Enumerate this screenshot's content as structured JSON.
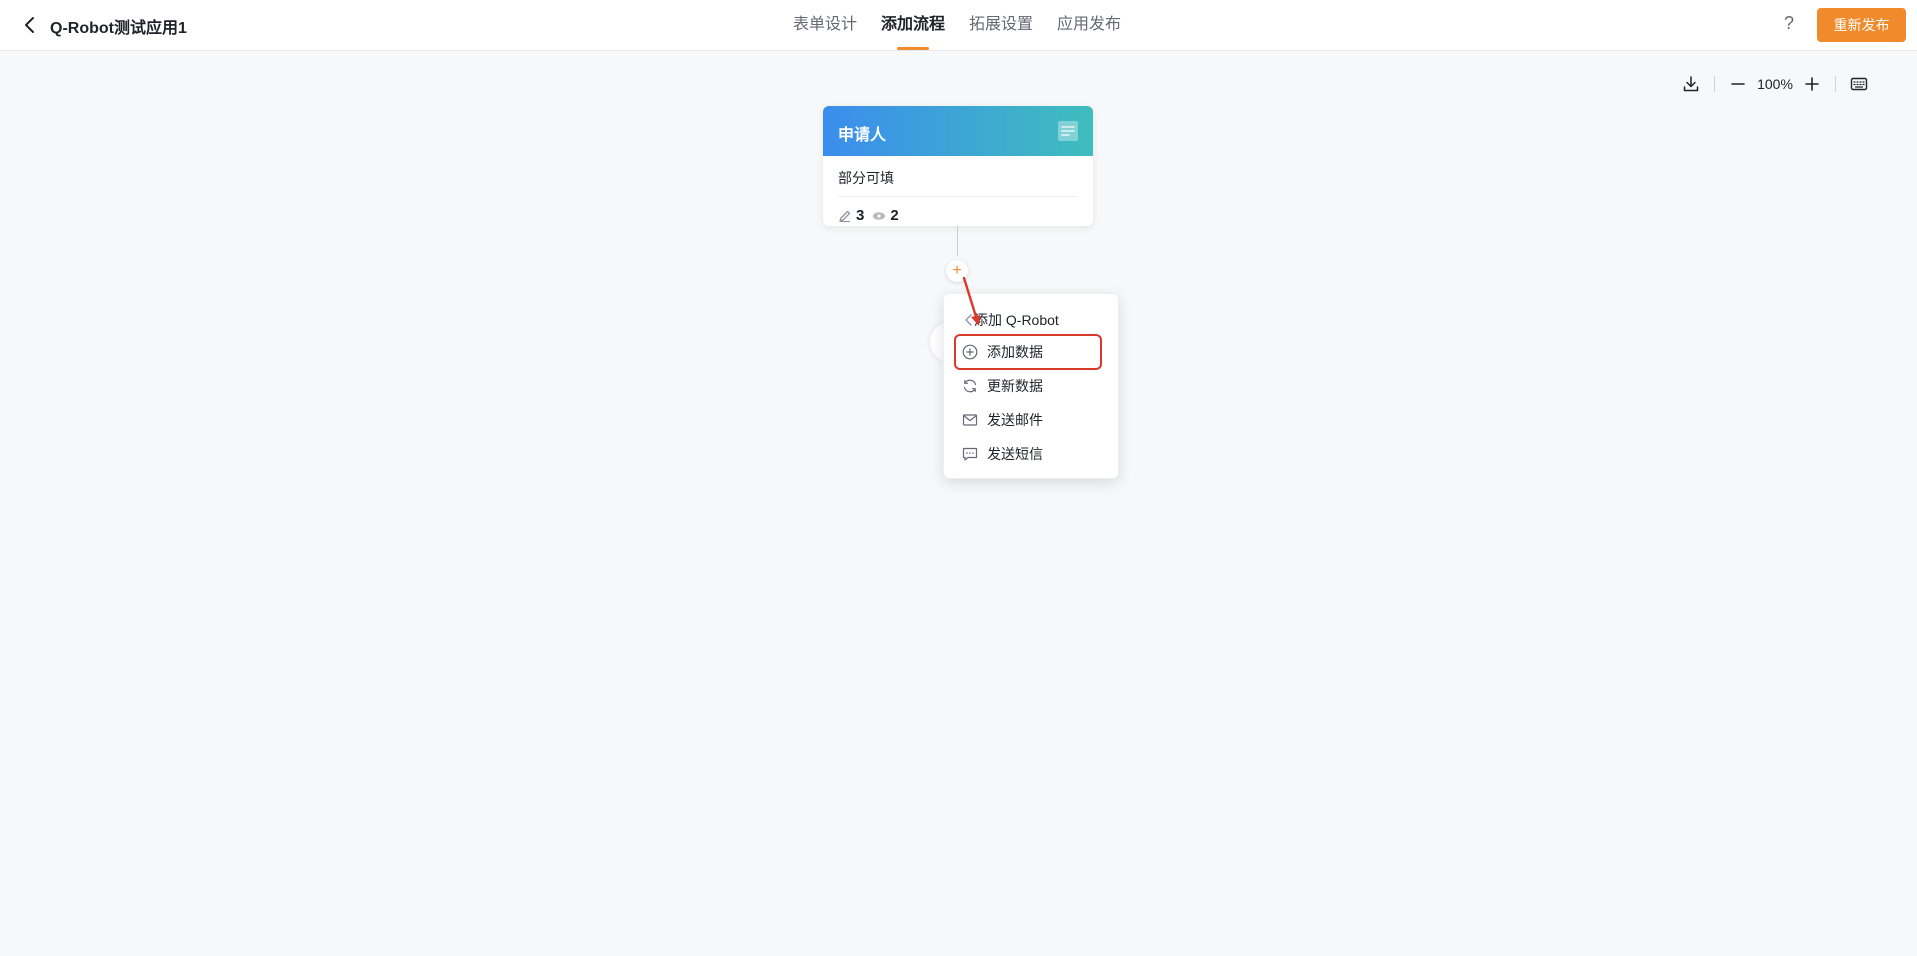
{
  "header": {
    "title": "Q-Robot测试应用1",
    "tabs": [
      {
        "label": "表单设计",
        "active": false
      },
      {
        "label": "添加流程",
        "active": true
      },
      {
        "label": "拓展设置",
        "active": false
      },
      {
        "label": "应用发布",
        "active": false
      }
    ],
    "help": "?",
    "publish_label": "重新发布"
  },
  "toolbar": {
    "zoom": "100%"
  },
  "node": {
    "title": "申请人",
    "subtitle": "部分可填",
    "edit_count": "3",
    "view_count": "2"
  },
  "plus_symbol": "+",
  "menu": {
    "header": "添加 Q-Robot",
    "items": [
      {
        "label": "添加数据",
        "icon": "plus-circle-icon",
        "highlighted": true
      },
      {
        "label": "更新数据",
        "icon": "refresh-icon",
        "highlighted": false
      },
      {
        "label": "发送邮件",
        "icon": "mail-icon",
        "highlighted": false
      },
      {
        "label": "发送短信",
        "icon": "message-icon",
        "highlighted": false
      }
    ]
  },
  "colors": {
    "accent": "#f08a2a",
    "highlight": "#d93a2b",
    "node_gradient_start": "#3b8ded",
    "node_gradient_end": "#3fbdbd"
  }
}
